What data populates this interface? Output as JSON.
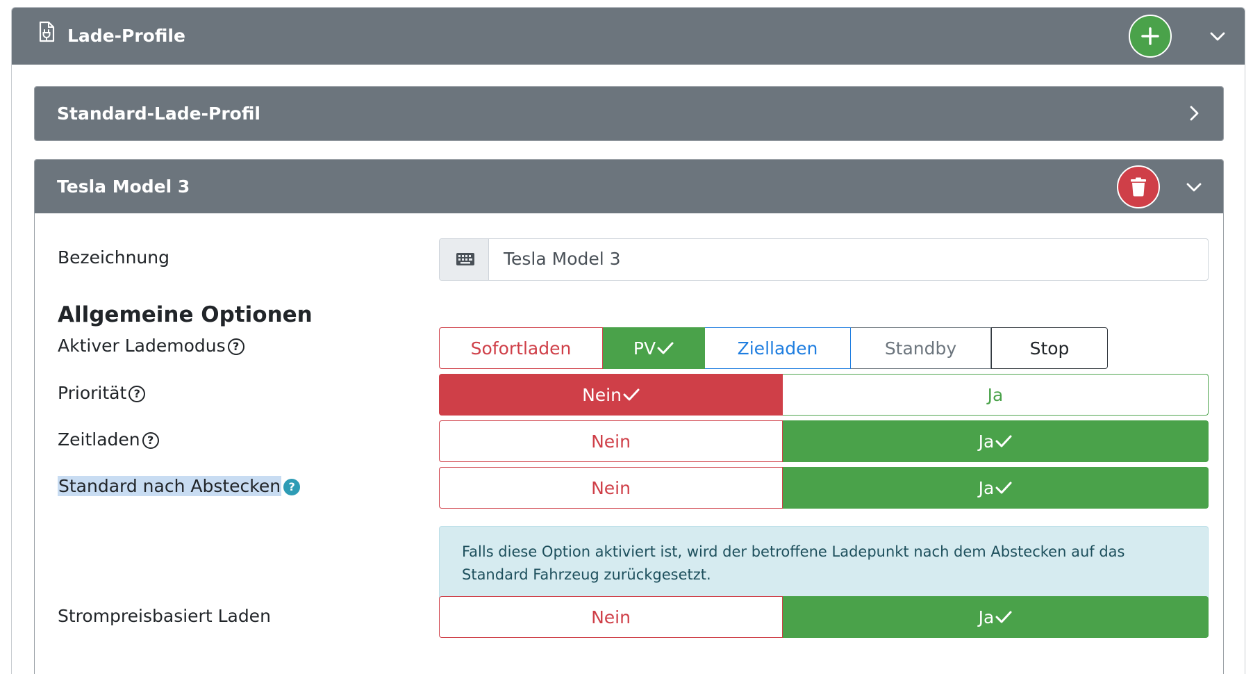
{
  "outer": {
    "title": "Lade-Profile",
    "icons": {
      "doc": "charging-profile-document-icon",
      "add": "plus-icon",
      "collapse": "chevron-down-icon"
    }
  },
  "card_standard": {
    "title": "Standard-Lade-Profil",
    "icon": "chevron-right-icon"
  },
  "card_tesla": {
    "title": "Tesla Model 3",
    "icons": {
      "delete": "trash-icon",
      "collapse": "chevron-down-icon"
    },
    "bezeichnung": {
      "label": "Bezeichnung",
      "value": "Tesla Model 3",
      "icon": "keyboard-icon"
    },
    "section_title": "Allgemeine Optionen",
    "lademodus": {
      "label": "Aktiver Lademodus",
      "options": [
        "Sofortladen",
        "PV",
        "Zielladen",
        "Standby",
        "Stop"
      ],
      "selected": "PV"
    },
    "prioritaet": {
      "label": "Priorität",
      "no": "Nein",
      "yes": "Ja",
      "selected": "Nein"
    },
    "zeitladen": {
      "label": "Zeitladen",
      "no": "Nein",
      "yes": "Ja",
      "selected": "Ja"
    },
    "standard_nach_abstecken": {
      "label": "Standard nach Abstecken",
      "no": "Nein",
      "yes": "Ja",
      "selected": "Ja",
      "info": "Falls diese Option aktiviert ist, wird der betroffene Ladepunkt nach dem Abstecken auf das Standard Fahrzeug zurückgesetzt."
    },
    "strompreis": {
      "label": "Strompreisbasiert Laden",
      "no": "Nein",
      "yes": "Ja",
      "selected": "Ja"
    }
  },
  "colors": {
    "header": "#6c757d",
    "success": "#4aa24a",
    "danger": "#cf3f48",
    "primary": "#1f7ee0",
    "info_bg": "#d6ebf0"
  }
}
